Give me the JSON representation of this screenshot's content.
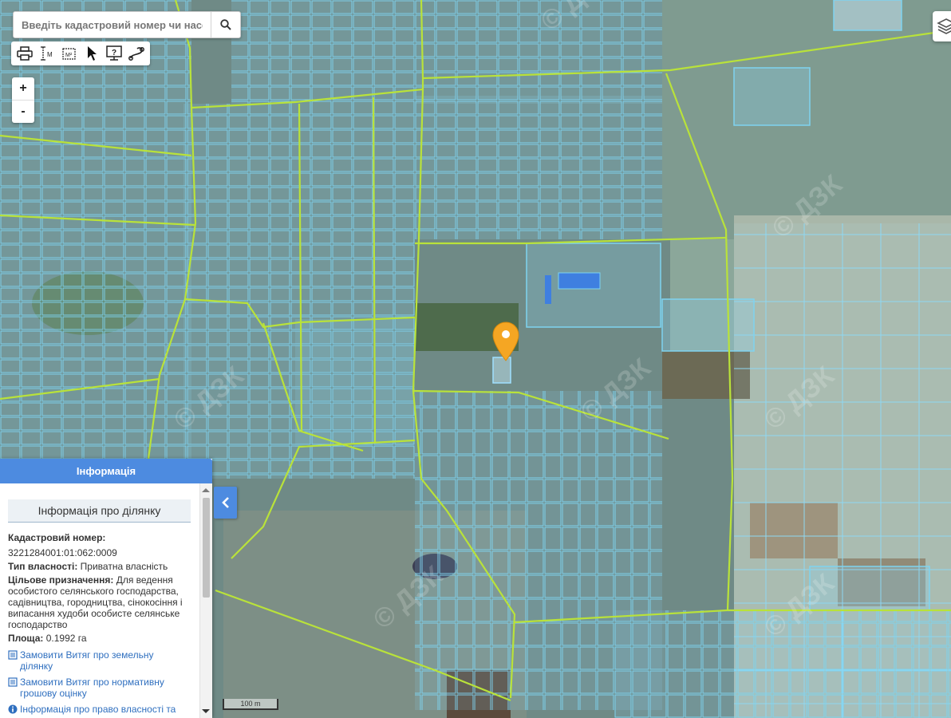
{
  "search": {
    "placeholder": "Введіть кадастровий номер чи населений пункт",
    "icon": "search-icon"
  },
  "toolbar": {
    "tools": [
      "print-icon",
      "measure-distance-icon",
      "measure-area-icon",
      "select-pointer-icon",
      "identify-icon",
      "route-icon"
    ]
  },
  "zoom": {
    "in_label": "+",
    "out_label": "-"
  },
  "map": {
    "watermark": "© ДЗК",
    "colors": {
      "parcel_outline": "#7fd3f0",
      "boundary_line": "#b9e23a",
      "marker": "#f5a623"
    }
  },
  "panel": {
    "title": "Інформація",
    "subtitle": "Інформація про ділянку",
    "cadastral_label": "Кадастровий номер:",
    "cadastral_value": "3221284001:01:062:0009",
    "ownership_label": "Тип власності:",
    "ownership_value": "Приватна власність",
    "purpose_label": "Цільове призначення:",
    "purpose_value": "Для ведення особистого селянського господарства, садівництва, городництва, сінокосіння і випасання худоби особисте селянське господарство",
    "area_label": "Площа:",
    "area_value": "0.1992 га",
    "links": [
      "Замовити Витяг про земельну ділянку",
      "Замовити Витяг про нормативну грошову оцінку",
      "Інформація про право власності та"
    ],
    "colors": {
      "header": "#4d8be0",
      "link": "#2f6fbf"
    }
  },
  "scale": {
    "label": "100 m"
  }
}
